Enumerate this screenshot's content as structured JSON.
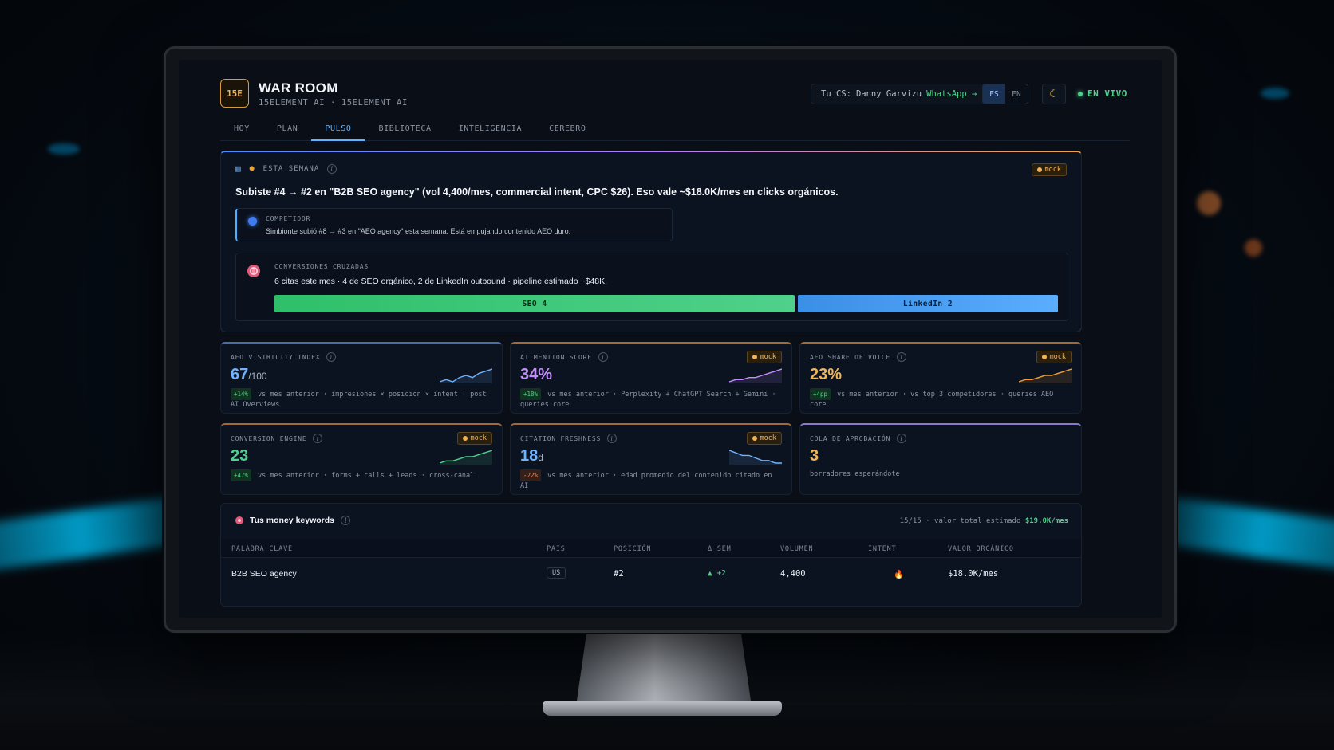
{
  "header": {
    "logo": "15E",
    "title": "WAR ROOM",
    "subtitle": "15ELEMENT AI · 15ELEMENT AI",
    "cs_label": "Tu CS:",
    "cs_name": "Danny Garvizu",
    "cs_link": "WhatsApp →",
    "lang_es": "ES",
    "lang_en": "EN",
    "live": "EN VIVO"
  },
  "tabs": [
    "HOY",
    "PLAN",
    "PULSO",
    "BIBLIOTECA",
    "INTELIGENCIA",
    "CEREBRO"
  ],
  "active_tab": "PULSO",
  "week": {
    "label": "ESTA SEMANA",
    "mock": "mock",
    "headline": "Subiste #4 → #2 en \"B2B SEO agency\" (vol 4,400/mes, commercial intent, CPC $26). Eso vale ~$18.0K/mes en clicks orgánicos.",
    "competitor_label": "COMPETIDOR",
    "competitor_text": "Simbionte subió #8 → #3 en \"AEO agency\" esta semana. Está empujando contenido AEO duro.",
    "conversions_label": "CONVERSIONES CRUZADAS",
    "conversions_text": "6 citas este mes · 4 de SEO orgánico, 2 de LinkedIn outbound · pipeline estimado ~$48K.",
    "bar_seo": "SEO 4",
    "bar_linkedin": "LinkedIn 2",
    "seo_share": 0.667,
    "linkedin_share": 0.333
  },
  "cards": [
    {
      "title": "AEO VISIBILITY INDEX",
      "value": "67",
      "unit": "/100",
      "delta": "+14%",
      "desc": "vs mes anterior · impresiones × posición × intent · post AI Overviews",
      "mock": false,
      "color": "#6fb3ff",
      "border": "#4a6da8",
      "trend": [
        3,
        4,
        3,
        5,
        6,
        5,
        7,
        8,
        9
      ],
      "spark_color": "#6fb3ff"
    },
    {
      "title": "AI MENTION SCORE",
      "value": "34%",
      "unit": "",
      "delta": "+18%",
      "desc": "vs mes anterior · Perplexity + ChatGPT Search + Gemini · queries core",
      "mock": true,
      "color": "#c58cff",
      "border": "#a06a3a",
      "trend": [
        2,
        3,
        3,
        4,
        4,
        5,
        6,
        7,
        8
      ],
      "spark_color": "#c58cff"
    },
    {
      "title": "AEO SHARE OF VOICE",
      "value": "23%",
      "unit": "",
      "delta": "+4pp",
      "desc": "vs mes anterior · vs top 3 competidores · queries AEO core",
      "mock": true,
      "color": "#f0b45a",
      "border": "#a06a3a",
      "trend": [
        2,
        3,
        3,
        4,
        5,
        5,
        6,
        7,
        8
      ],
      "spark_color": "#f0a030"
    },
    {
      "title": "CONVERSION ENGINE",
      "value": "23",
      "unit": "",
      "delta": "+47%",
      "desc": "vs mes anterior · forms + calls + leads · cross-canal",
      "mock": true,
      "color": "#4fd18b",
      "border": "#a06a3a",
      "trend": [
        2,
        3,
        3,
        4,
        5,
        5,
        6,
        7,
        8
      ],
      "spark_color": "#4fd18b"
    },
    {
      "title": "CITATION FRESHNESS",
      "value": "18",
      "unit": "d",
      "delta": "-22%",
      "desc": "vs mes anterior · edad promedio del contenido citado en AI",
      "mock": true,
      "color": "#6fb3ff",
      "border": "#a06a3a",
      "trend": [
        8,
        7,
        6,
        6,
        5,
        4,
        4,
        3,
        3
      ],
      "spark_color": "#6fb3ff"
    },
    {
      "title": "COLA DE APROBACIÓN",
      "value": "3",
      "unit": "",
      "delta": "",
      "desc": "borradores esperándote",
      "mock": false,
      "color": "#f0b45a",
      "border": "#8a78c8",
      "trend": [],
      "spark_color": ""
    }
  ],
  "keywords": {
    "title": "Tus money keywords",
    "summary_prefix": "15/15 · valor total estimado",
    "summary_value": "$19.0K/mes",
    "columns": [
      "PALABRA CLAVE",
      "PAÍS",
      "POSICIÓN",
      "Δ SEM",
      "VOLUMEN",
      "INTENT",
      "VALOR ORGÁNICO"
    ],
    "rows": [
      {
        "keyword": "B2B SEO agency",
        "country": "US",
        "position": "#2",
        "delta": "▲ +2",
        "volume": "4,400",
        "intent": "🔥",
        "value": "$18.0K/mes"
      }
    ]
  }
}
